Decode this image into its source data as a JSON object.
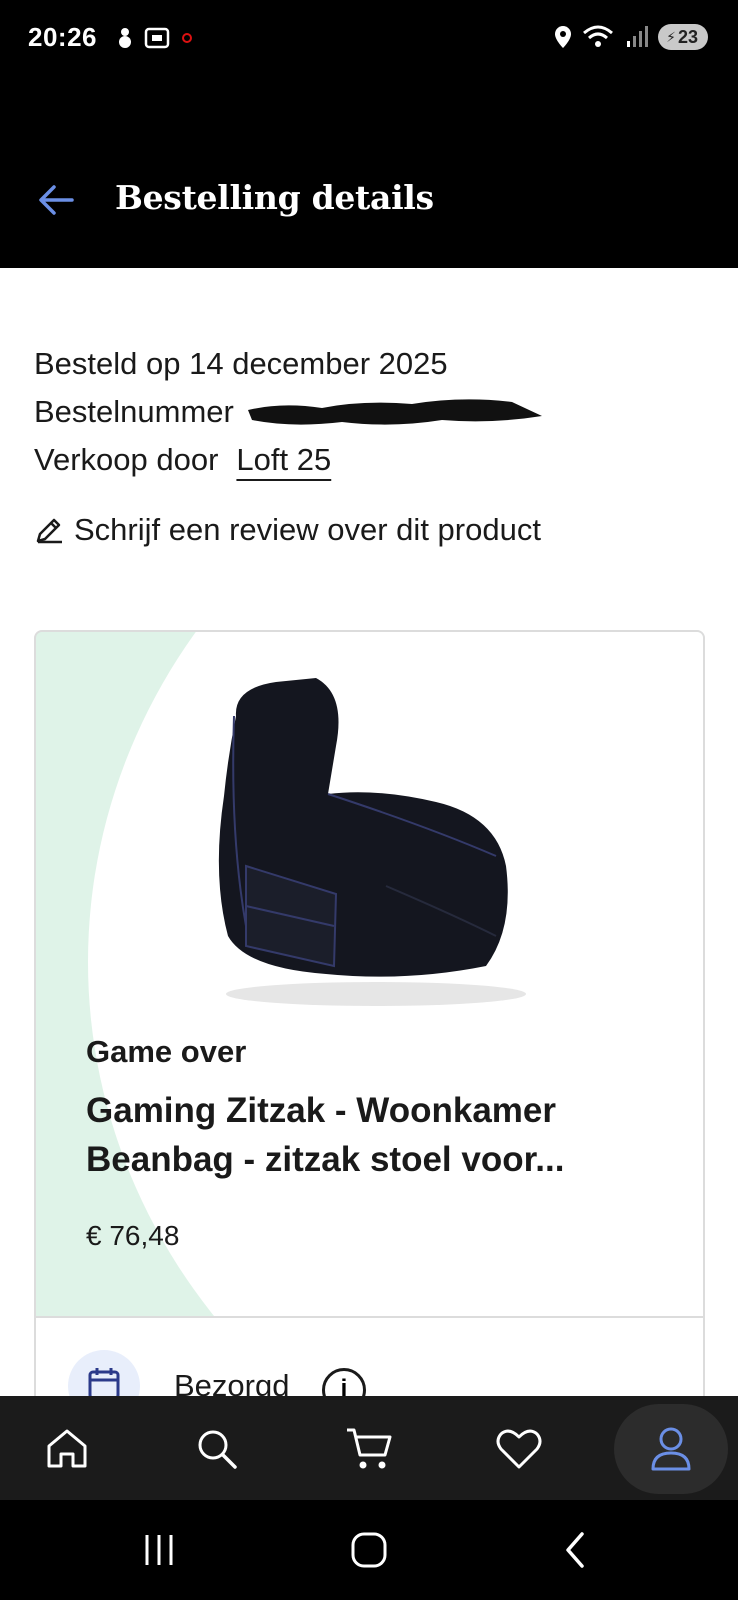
{
  "status_bar": {
    "time": "20:26",
    "battery": "23",
    "icons": [
      "snowman-icon",
      "screenshot-icon",
      "notification-dot-icon",
      "location-icon",
      "wifi-icon",
      "signal-icon",
      "battery-icon"
    ]
  },
  "app_bar": {
    "title": "Bestelling details",
    "back_icon": "arrow-left-icon",
    "accent_color": "#6b8fe6"
  },
  "order": {
    "ordered_on": "Besteld op 14 december 2025",
    "order_number_label": "Bestelnummer",
    "seller_label": "Verkoop door",
    "seller_name": "Loft 25",
    "review_link": "Schrijf een review over dit product"
  },
  "product": {
    "brand": "Game over",
    "title": "Gaming Zitzak - Woonkamer Beanbag - zitzak stoel voor...",
    "price": "€ 76,48",
    "card_bg_color": "#dff3e8"
  },
  "delivery": {
    "status": "Bezorgd"
  },
  "bottom_nav": {
    "items": [
      "home-icon",
      "search-icon",
      "cart-icon",
      "heart-icon",
      "profile-icon"
    ],
    "active": "profile-icon"
  },
  "system_nav": {
    "items": [
      "recents-icon",
      "home-icon",
      "back-icon"
    ]
  }
}
